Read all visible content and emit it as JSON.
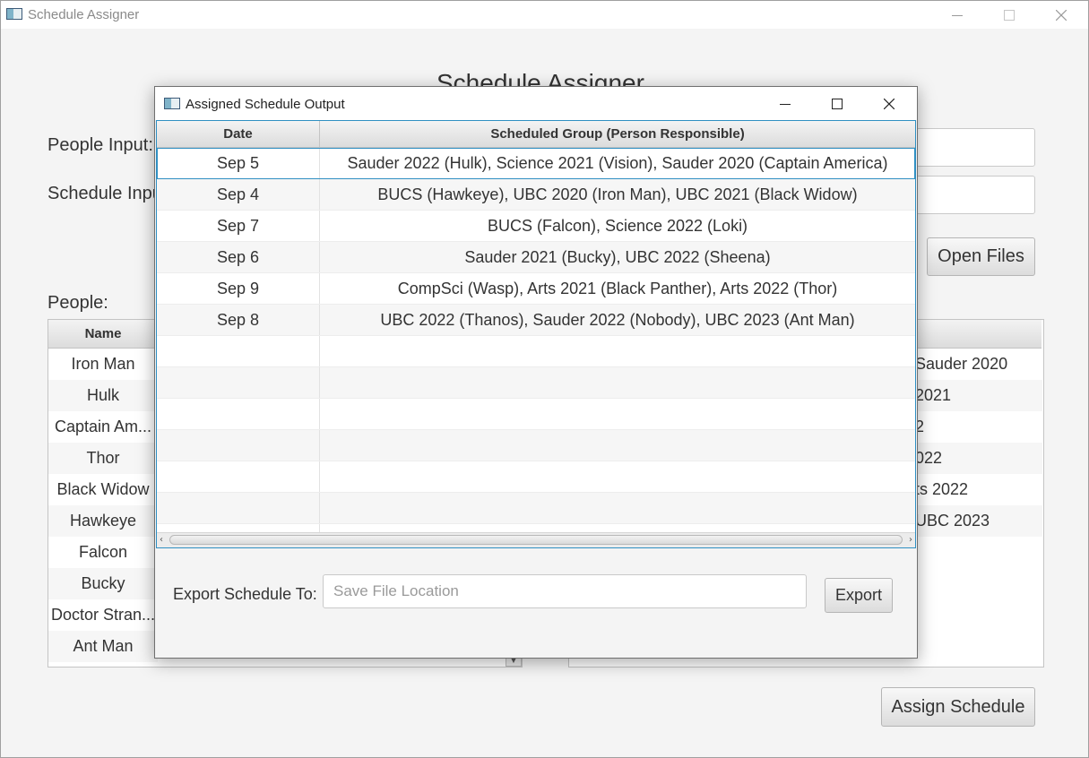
{
  "main_window": {
    "title": "Schedule Assigner",
    "heading": "Schedule Assigner",
    "people_input_label": "People Input:",
    "schedule_input_label": "Schedule Input:",
    "open_files_label": "Open Files",
    "people_label": "People:",
    "assign_schedule_label": "Assign Schedule",
    "people_table": {
      "name_header": "Name",
      "names": [
        "Iron Man",
        "Hulk",
        "Captain Am...",
        "Thor",
        "Black Widow",
        "Hawkeye",
        "Falcon",
        "Bucky",
        "Doctor Stran...",
        "Ant Man"
      ]
    },
    "right_table_partial": [
      "Sauder 2020",
      " 2021",
      "2",
      "022",
      "ts 2022",
      "UBC 2023"
    ]
  },
  "dialog": {
    "title": "Assigned Schedule Output",
    "columns": [
      "Date",
      "Scheduled Group (Person Responsible)"
    ],
    "rows": [
      {
        "date": "Sep 5",
        "group": "Sauder 2022 (Hulk), Science 2021 (Vision), Sauder 2020 (Captain America)"
      },
      {
        "date": "Sep 4",
        "group": "BUCS (Hawkeye), UBC 2020 (Iron Man), UBC 2021 (Black Widow)"
      },
      {
        "date": "Sep 7",
        "group": "BUCS (Falcon), Science 2022 (Loki)"
      },
      {
        "date": "Sep 6",
        "group": "Sauder 2021 (Bucky), UBC 2022 (Sheena)"
      },
      {
        "date": "Sep 9",
        "group": "CompSci (Wasp), Arts 2021 (Black Panther), Arts 2022 (Thor)"
      },
      {
        "date": "Sep 8",
        "group": "UBC 2022 (Thanos), Sauder 2022 (Nobody), UBC 2023 (Ant Man)"
      }
    ],
    "export_label": "Export Schedule To:",
    "save_placeholder": "Save File Location",
    "export_button": "Export"
  },
  "colors": {
    "accent": "#2f8fc2",
    "window_bg": "#f4f4f4"
  }
}
